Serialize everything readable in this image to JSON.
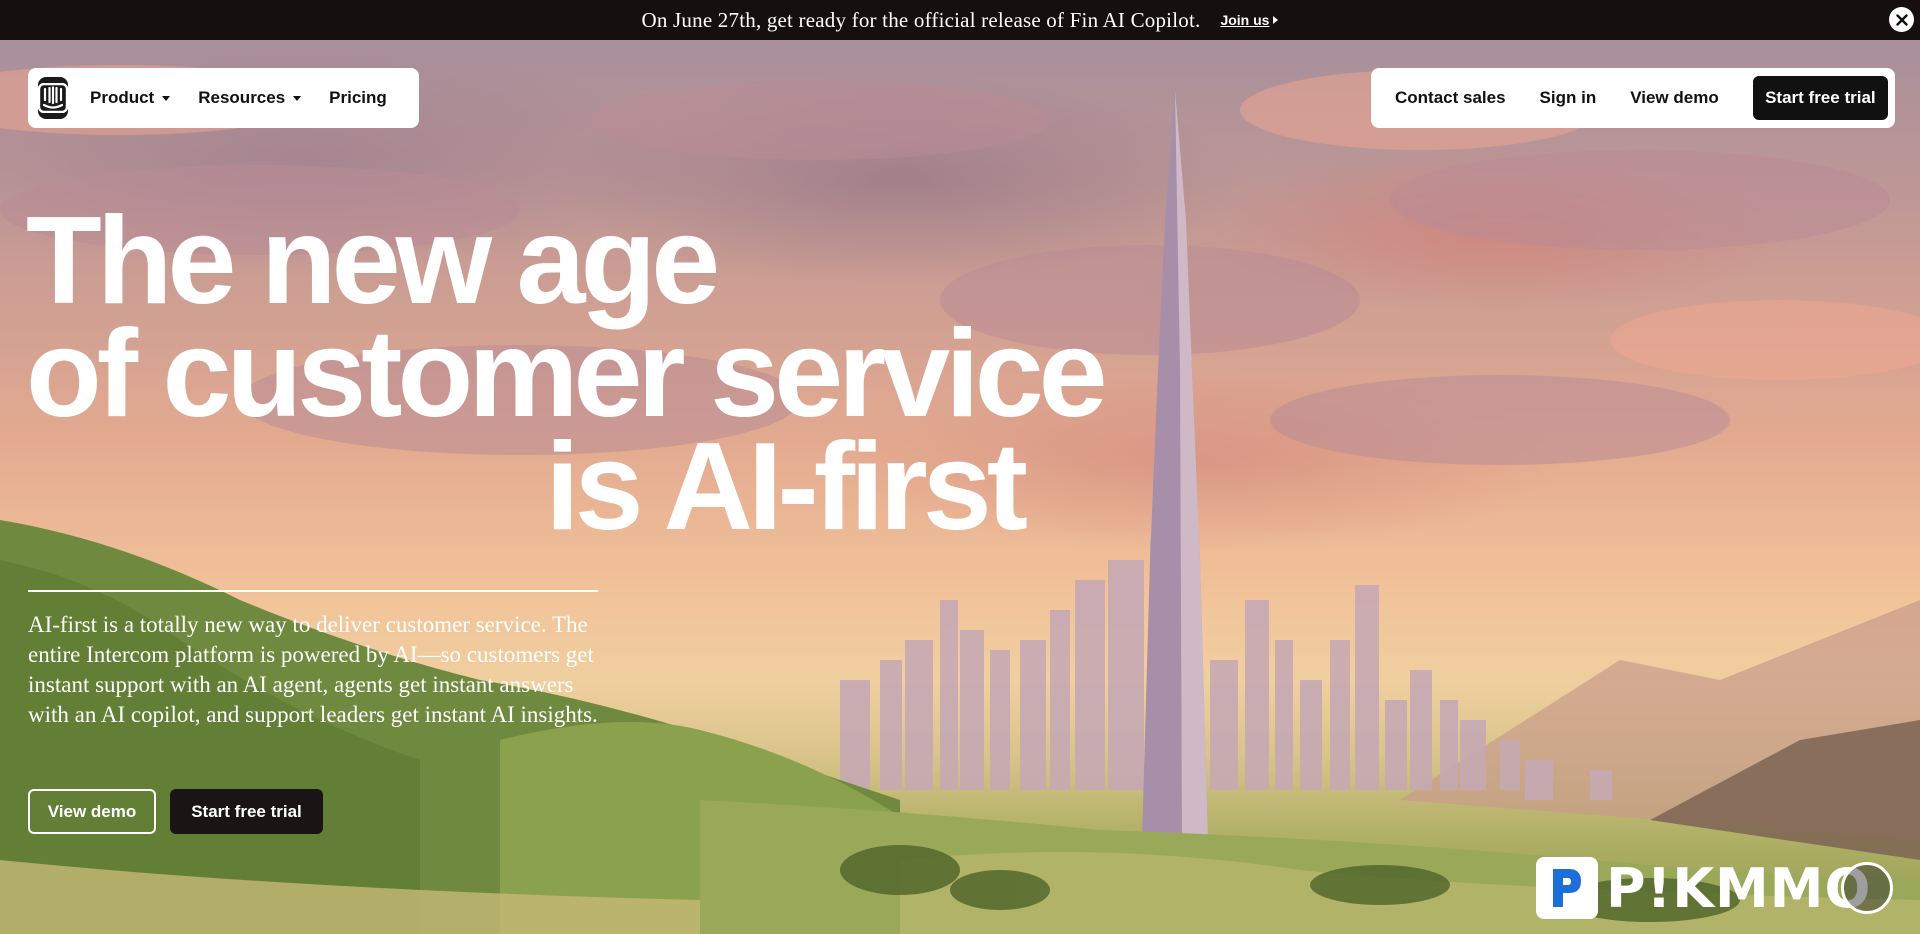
{
  "announcement": {
    "text": "On June 27th, get ready for the official release of Fin AI Copilot.",
    "link_label": "Join us"
  },
  "nav": {
    "logo_icon": "intercom-logo-icon",
    "left_items": [
      {
        "label": "Product",
        "has_dropdown": true
      },
      {
        "label": "Resources",
        "has_dropdown": true
      },
      {
        "label": "Pricing",
        "has_dropdown": false
      }
    ],
    "right_items": [
      {
        "label": "Contact sales"
      },
      {
        "label": "Sign in"
      },
      {
        "label": "View demo"
      }
    ],
    "cta_label": "Start free trial"
  },
  "hero": {
    "headline_line1": "The new age",
    "headline_line2": "of customer service",
    "headline_line3": "is AI-first",
    "description": "AI-first is a totally new way to deliver customer service. The entire Intercom platform is powered by AI—so customers get instant support with an AI agent, agents get instant answers with an AI copilot, and support leaders get instant AI insights.",
    "view_demo_label": "View demo",
    "start_trial_label": "Start free trial"
  },
  "watermark": {
    "text": "P!KMMO"
  },
  "colors": {
    "announcement_bg": "#150f0f",
    "cta_bg": "#111111",
    "text_light": "#ffffff"
  }
}
